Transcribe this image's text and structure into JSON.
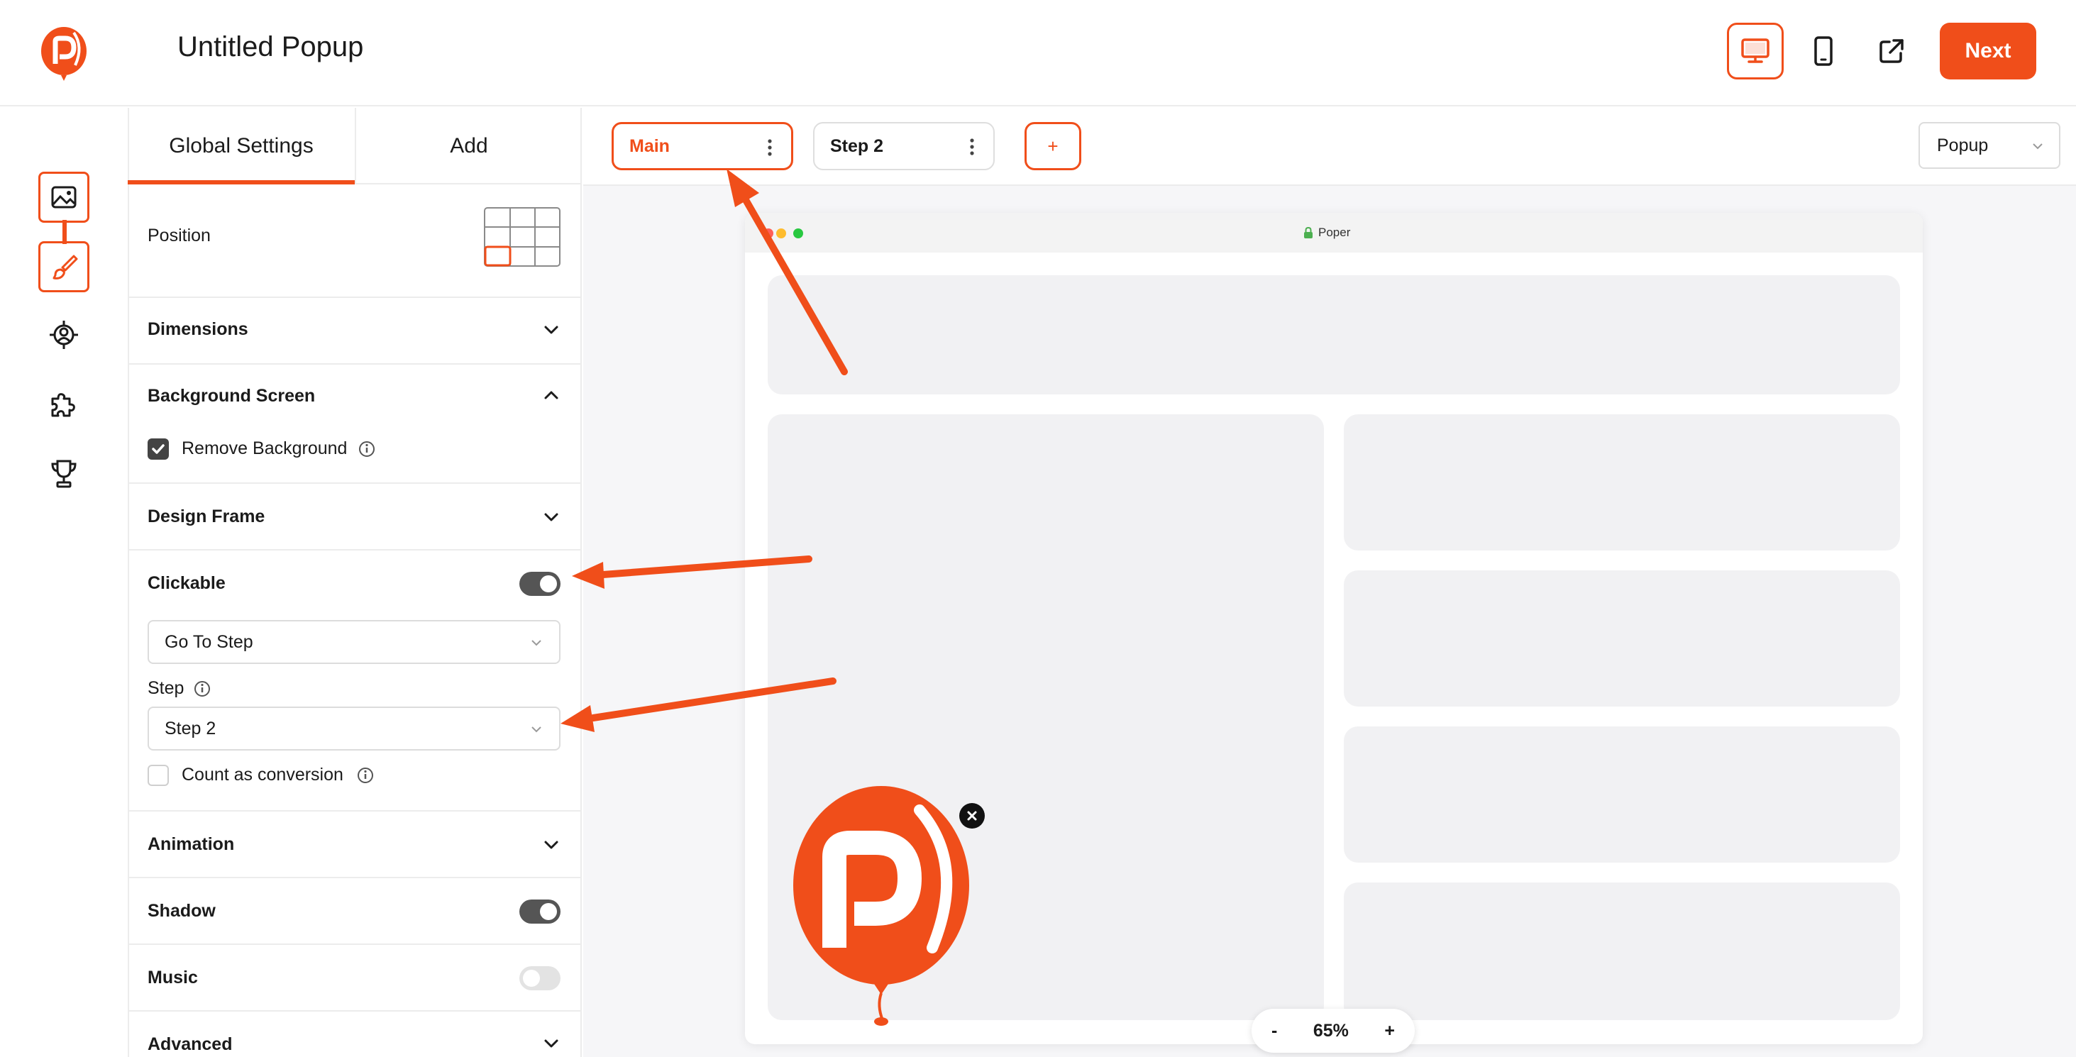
{
  "header": {
    "title": "Untitled Popup",
    "next_label": "Next",
    "brand_color": "#f04e1a"
  },
  "rail": {
    "icons": [
      "image-icon",
      "brush-icon",
      "target-icon",
      "puzzle-icon",
      "trophy-icon"
    ]
  },
  "panel": {
    "tabs": [
      "Global Settings",
      "Add"
    ],
    "position_label": "Position",
    "sections": {
      "dimensions": "Dimensions",
      "background_screen": "Background Screen",
      "remove_background": "Remove Background",
      "design_frame": "Design Frame",
      "clickable": "Clickable",
      "action_select": "Go To Step",
      "step_label": "Step",
      "step_select": "Step 2",
      "count_conversion": "Count as conversion",
      "animation": "Animation",
      "shadow": "Shadow",
      "music": "Music",
      "advanced": "Advanced"
    }
  },
  "canvas": {
    "steps": [
      "Main",
      "Step 2"
    ],
    "add_step_label": "+",
    "type_select": "Popup",
    "browser_url": "Poper",
    "zoom": {
      "minus": "-",
      "value": "65%",
      "plus": "+"
    }
  }
}
